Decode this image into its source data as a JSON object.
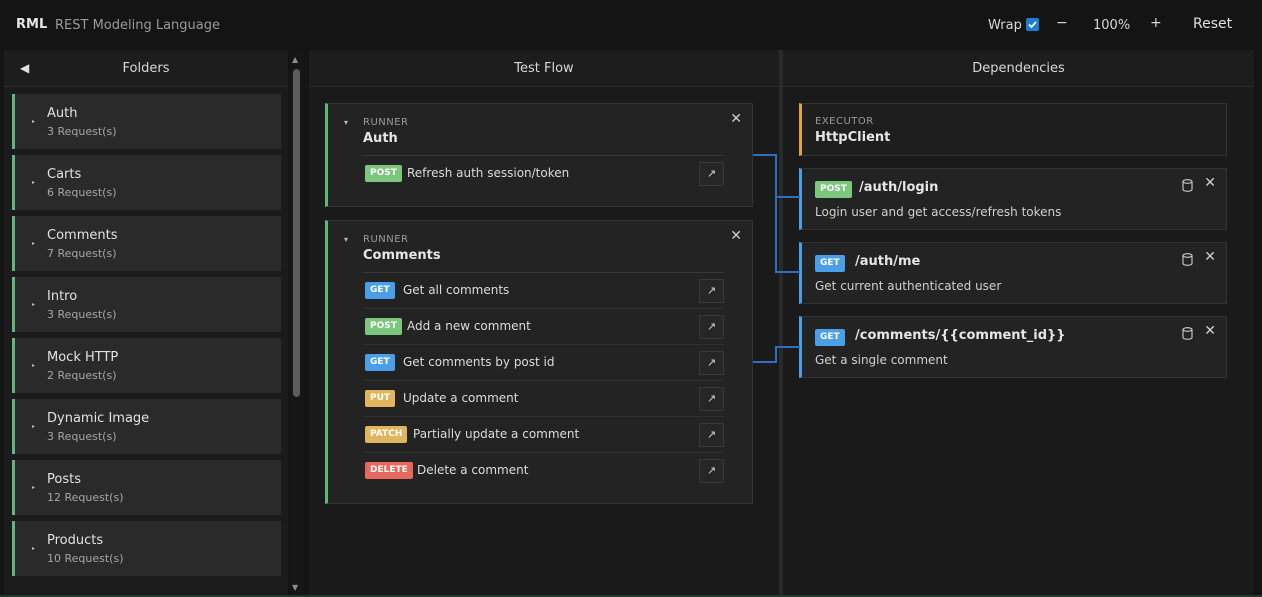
{
  "app": {
    "name": "RML",
    "subtitle": "REST Modeling Language"
  },
  "toolbar": {
    "wrap_label": "Wrap",
    "wrap_checked": true,
    "zoom_out": "−",
    "zoom_level": "100%",
    "zoom_in": "+",
    "reset_label": "Reset"
  },
  "folders": {
    "header": "Folders",
    "collapse_icon": "◀",
    "items": [
      {
        "name": "Auth",
        "count": "3 Request(s)"
      },
      {
        "name": "Carts",
        "count": "6 Request(s)"
      },
      {
        "name": "Comments",
        "count": "7 Request(s)"
      },
      {
        "name": "Intro",
        "count": "3 Request(s)"
      },
      {
        "name": "Mock HTTP",
        "count": "2 Request(s)"
      },
      {
        "name": "Dynamic Image",
        "count": "3 Request(s)"
      },
      {
        "name": "Posts",
        "count": "12 Request(s)"
      },
      {
        "name": "Products",
        "count": "10 Request(s)"
      }
    ]
  },
  "testflow": {
    "header": "Test Flow",
    "runners": [
      {
        "label": "RUNNER",
        "title": "Auth",
        "requests": [
          {
            "method": "POST",
            "name": "Refresh auth session/token"
          }
        ]
      },
      {
        "label": "RUNNER",
        "title": "Comments",
        "requests": [
          {
            "method": "GET",
            "name": "Get all comments"
          },
          {
            "method": "POST",
            "name": "Add a new comment"
          },
          {
            "method": "GET",
            "name": "Get comments by post id"
          },
          {
            "method": "PUT",
            "name": "Update a comment"
          },
          {
            "method": "PATCH",
            "name": "Partially update a comment"
          },
          {
            "method": "DELETE",
            "name": "Delete a comment"
          }
        ]
      }
    ]
  },
  "dependencies": {
    "header": "Dependencies",
    "executor": {
      "label": "EXECUTOR",
      "title": "HttpClient"
    },
    "items": [
      {
        "method": "POST",
        "path": "/auth/login",
        "description": "Login user and get access/refresh tokens"
      },
      {
        "method": "GET",
        "path": "/auth/me",
        "description": "Get current authenticated user"
      },
      {
        "method": "GET",
        "path": "/comments/{{comment_id}}",
        "description": "Get a single comment"
      }
    ]
  },
  "icons": {
    "close": "✕",
    "open": "↗",
    "caret": "▸",
    "expand": "▾"
  },
  "colors": {
    "accent_green": "#5fb878",
    "executor_orange": "#e3a53b",
    "dependency_blue": "#4a9fe8",
    "connector": "#2e6fc0",
    "method_get": "#4a9fe8",
    "method_post": "#7cc77e",
    "method_put": "#e0b55e",
    "method_patch": "#e0b55e",
    "method_delete": "#e8685c"
  }
}
